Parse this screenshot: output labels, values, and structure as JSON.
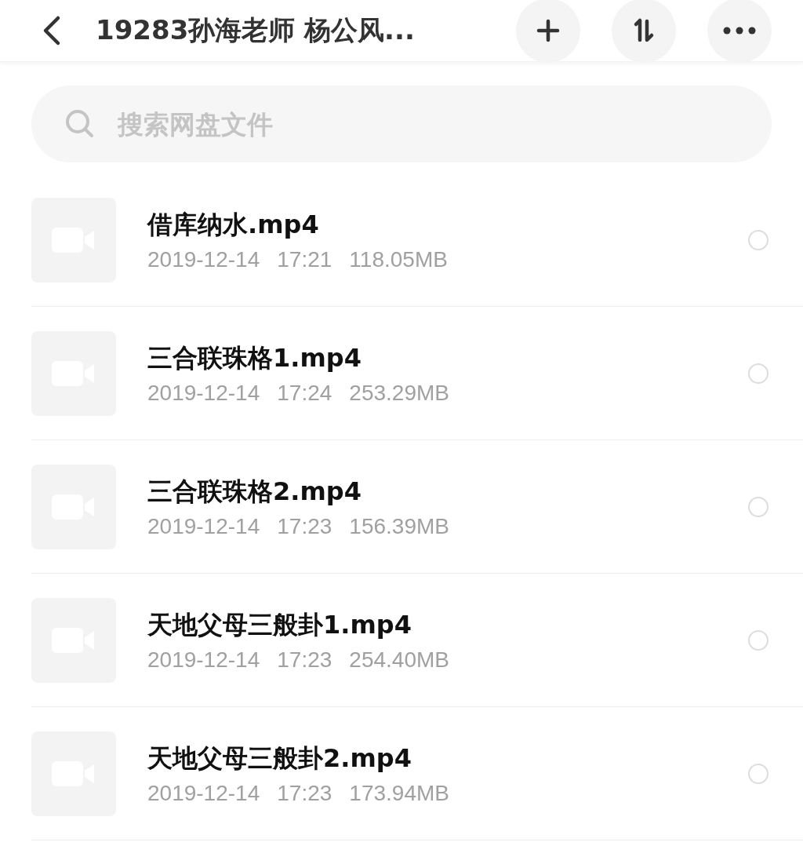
{
  "header": {
    "title": "19283孙海老师 杨公风..."
  },
  "search": {
    "placeholder": "搜索网盘文件"
  },
  "files": [
    {
      "name": "借库纳水.mp4",
      "date": "2019-12-14",
      "time": "17:21",
      "size": "118.05MB",
      "selected": false
    },
    {
      "name": "三合联珠格1.mp4",
      "date": "2019-12-14",
      "time": "17:24",
      "size": "253.29MB",
      "selected": false
    },
    {
      "name": "三合联珠格2.mp4",
      "date": "2019-12-14",
      "time": "17:23",
      "size": "156.39MB",
      "selected": false
    },
    {
      "name": "天地父母三般卦1.mp4",
      "date": "2019-12-14",
      "time": "17:23",
      "size": "254.40MB",
      "selected": false
    },
    {
      "name": "天地父母三般卦2.mp4",
      "date": "2019-12-14",
      "time": "17:23",
      "size": "173.94MB",
      "selected": false
    }
  ]
}
